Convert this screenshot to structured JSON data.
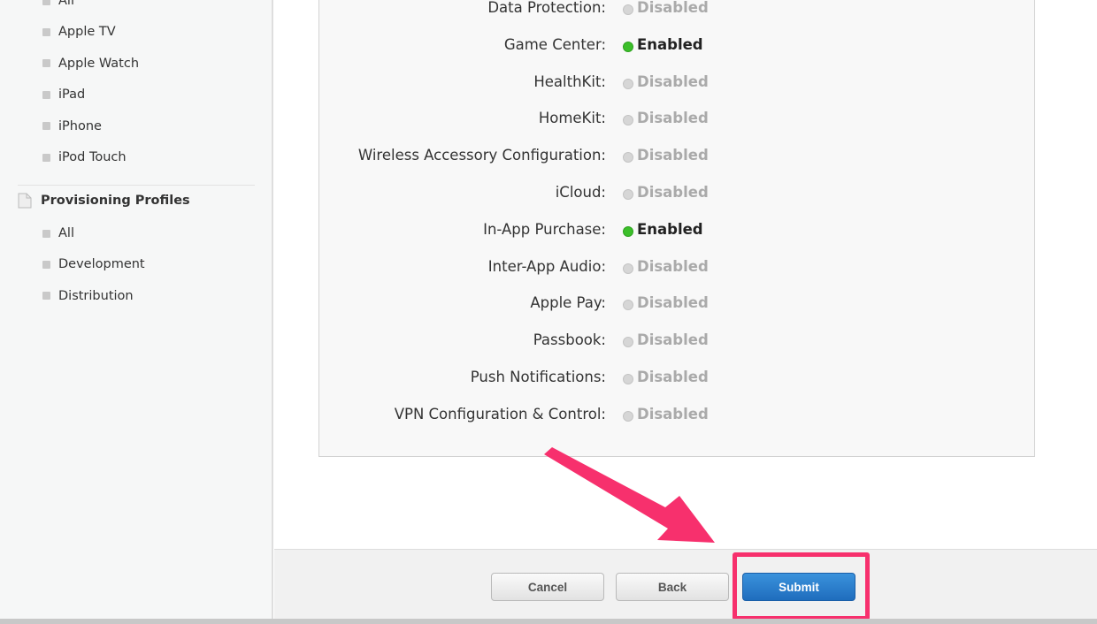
{
  "sidebar": {
    "device_items": [
      "All",
      "Apple TV",
      "Apple Watch",
      "iPad",
      "iPhone",
      "iPod Touch"
    ],
    "section_title": "Provisioning Profiles",
    "section_icon": "document-icon",
    "profile_items": [
      "All",
      "Development",
      "Distribution"
    ]
  },
  "services": [
    {
      "label": "Data Protection:",
      "status": "Disabled",
      "enabled": false
    },
    {
      "label": "Game Center:",
      "status": "Enabled",
      "enabled": true
    },
    {
      "label": "HealthKit:",
      "status": "Disabled",
      "enabled": false
    },
    {
      "label": "HomeKit:",
      "status": "Disabled",
      "enabled": false
    },
    {
      "label": "Wireless Accessory Configuration:",
      "status": "Disabled",
      "enabled": false
    },
    {
      "label": "iCloud:",
      "status": "Disabled",
      "enabled": false
    },
    {
      "label": "In-App Purchase:",
      "status": "Enabled",
      "enabled": true
    },
    {
      "label": "Inter-App Audio:",
      "status": "Disabled",
      "enabled": false
    },
    {
      "label": "Apple Pay:",
      "status": "Disabled",
      "enabled": false
    },
    {
      "label": "Passbook:",
      "status": "Disabled",
      "enabled": false
    },
    {
      "label": "Push Notifications:",
      "status": "Disabled",
      "enabled": false
    },
    {
      "label": "VPN Configuration & Control:",
      "status": "Disabled",
      "enabled": false
    }
  ],
  "footer": {
    "cancel": "Cancel",
    "back": "Back",
    "submit": "Submit"
  },
  "colors": {
    "enabled": "#3cbf2a",
    "submit": "#2a7fd0",
    "annotation": "#f7306d"
  }
}
